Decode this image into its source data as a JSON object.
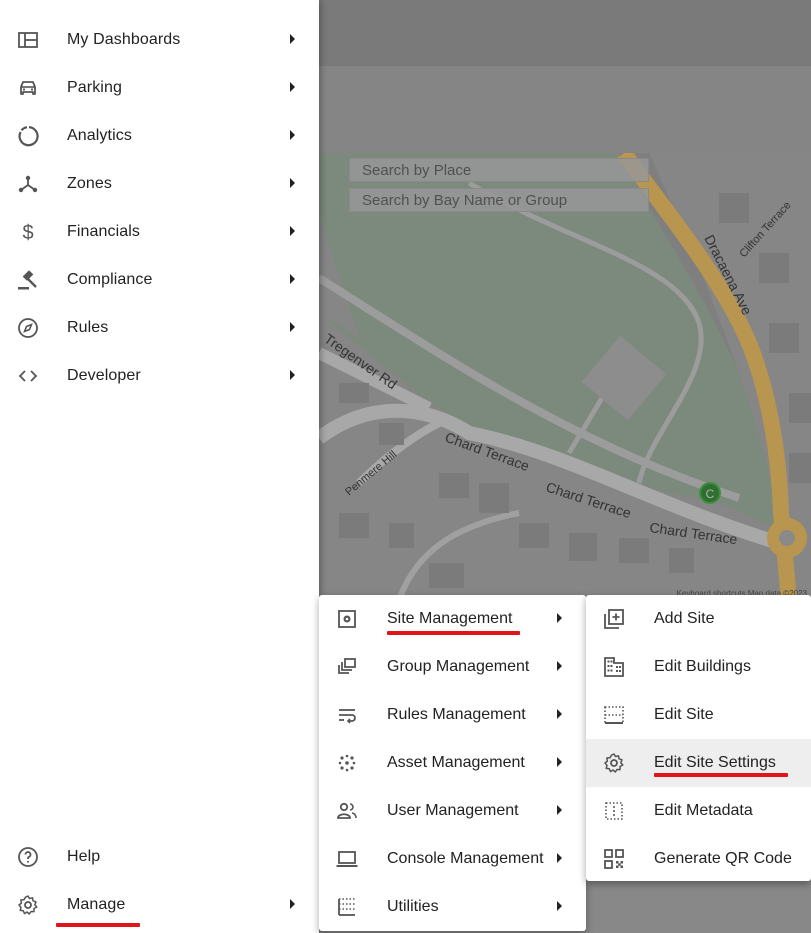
{
  "map": {
    "search_place_placeholder": "Search by Place",
    "search_bay_placeholder": "Search by Bay Name or Group",
    "streets": [
      "Dracaena Ave",
      "Clifton Terrace",
      "Tregenver Rd",
      "Penmere Hill",
      "Chard Terrace",
      "Chard Terrace",
      "Chard Terrace"
    ],
    "marker_label": "C",
    "footer": "Keyboard shortcuts    Map data ©2023"
  },
  "sidebar": {
    "items": [
      {
        "label": "My Dashboards",
        "icon": "dashboard-icon"
      },
      {
        "label": "Parking",
        "icon": "car-icon"
      },
      {
        "label": "Analytics",
        "icon": "donut-chart-icon"
      },
      {
        "label": "Zones",
        "icon": "hub-icon"
      },
      {
        "label": "Financials",
        "icon": "dollar-icon"
      },
      {
        "label": "Compliance",
        "icon": "gavel-icon"
      },
      {
        "label": "Rules",
        "icon": "compass-icon"
      },
      {
        "label": "Developer",
        "icon": "code-icon"
      }
    ],
    "help_label": "Help",
    "manage_label": "Manage"
  },
  "manage_menu": {
    "items": [
      {
        "label": "Site Management",
        "icon": "site-settings-icon"
      },
      {
        "label": "Group Management",
        "icon": "group-icon"
      },
      {
        "label": "Rules Management",
        "icon": "wrap-text-icon"
      },
      {
        "label": "Asset Management",
        "icon": "scatter-dots-icon"
      },
      {
        "label": "User Management",
        "icon": "users-icon"
      },
      {
        "label": "Console Management",
        "icon": "laptop-icon"
      },
      {
        "label": "Utilities",
        "icon": "grid-dots-icon"
      }
    ]
  },
  "site_menu": {
    "items": [
      {
        "label": "Add Site",
        "icon": "add-box-icon"
      },
      {
        "label": "Edit Buildings",
        "icon": "building-icon"
      },
      {
        "label": "Edit Site",
        "icon": "dotted-border-icon"
      },
      {
        "label": "Edit Site Settings",
        "icon": "gear-icon"
      },
      {
        "label": "Edit Metadata",
        "icon": "dotted-square-icon"
      },
      {
        "label": "Generate QR Code",
        "icon": "qr-code-icon"
      }
    ]
  },
  "colors": {
    "highlight_underline": "#e0141b",
    "active_row": "#eeeeee",
    "road_yellow": "#d6a94f"
  }
}
